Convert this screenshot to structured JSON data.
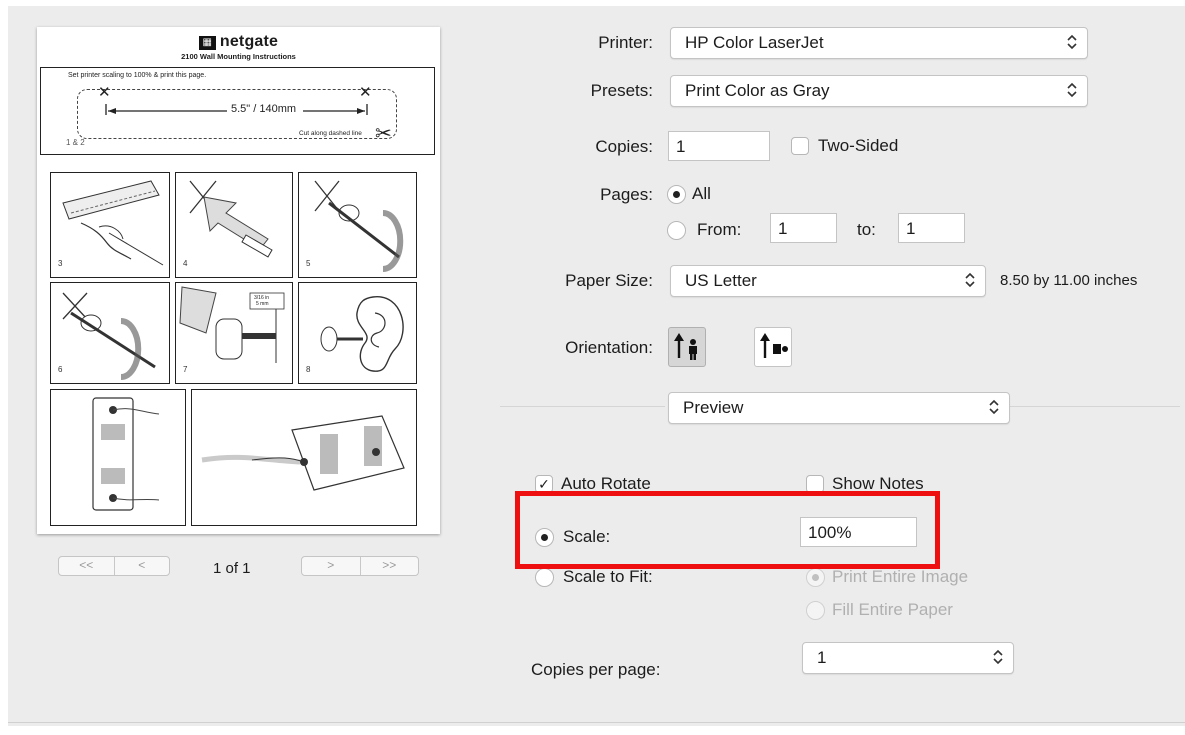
{
  "preview": {
    "brand": "netgate",
    "subtitle": "2100 Wall Mounting Instructions",
    "instruction": "Set printer scaling to 100% & print this page.",
    "measure": "5.5\" / 140mm",
    "cut_text": "Cut along dashed line",
    "step_first": "1 & 2",
    "step_labels": [
      "3",
      "4",
      "5",
      "6",
      "7",
      "8"
    ],
    "dim_label_a": "3/16 in",
    "dim_label_b": "5 mm"
  },
  "pager": {
    "first": "<<",
    "prev": "<",
    "page_indicator": "1 of 1",
    "next": ">",
    "last": ">>"
  },
  "form": {
    "printer_label": "Printer:",
    "printer_value": "HP Color LaserJet",
    "presets_label": "Presets:",
    "presets_value": "Print Color as Gray",
    "copies_label": "Copies:",
    "copies_value": "1",
    "two_sided_label": "Two-Sided",
    "two_sided_checked": false,
    "pages_label": "Pages:",
    "pages_all_label": "All",
    "pages_from_label": "From:",
    "pages_from_value": "1",
    "pages_to_label": "to:",
    "pages_to_value": "1",
    "paper_size_label": "Paper Size:",
    "paper_size_value": "US Letter",
    "paper_size_dims": "8.50 by 11.00 inches",
    "orientation_label": "Orientation:",
    "section_value": "Preview",
    "auto_rotate_label": "Auto Rotate",
    "auto_rotate_checked": true,
    "show_notes_label": "Show Notes",
    "show_notes_checked": false,
    "scale_label": "Scale:",
    "scale_value": "100%",
    "scale_to_fit_label": "Scale to Fit:",
    "print_entire_image_label": "Print Entire Image",
    "fill_entire_paper_label": "Fill Entire Paper",
    "copies_per_page_label": "Copies per page:",
    "copies_per_page_value": "1"
  },
  "colors": {
    "highlight": "#ee1010",
    "dialog_bg": "#ececec"
  }
}
